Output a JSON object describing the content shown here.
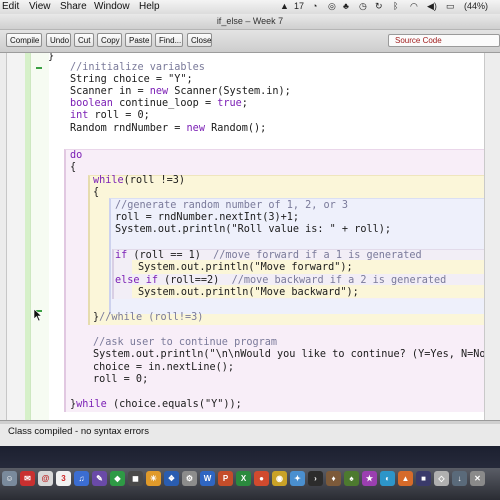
{
  "menubar": {
    "items": [
      "Edit",
      "View",
      "Share",
      "Window",
      "Help"
    ],
    "battery": "(44%)",
    "tray_count": "17"
  },
  "window": {
    "title": "if_else – Week 7"
  },
  "toolbar": {
    "compile": "Compile",
    "undo": "Undo",
    "cut": "Cut",
    "copy": "Copy",
    "paste": "Paste",
    "find": "Find...",
    "close": "Close",
    "view_select": "Source Code"
  },
  "code": {
    "l0": "}",
    "comment_init": "//initialize variables",
    "l_choice": "String choice = \"Y\";",
    "l_scanner_a": "Scanner in = ",
    "l_scanner_kw": "new",
    "l_scanner_b": " Scanner(System.in);",
    "l_bool_kw": "boolean",
    "l_bool_b": " continue_loop = ",
    "l_bool_kw2": "true",
    "l_bool_c": ";",
    "l_int_kw": "int",
    "l_int_b": " roll = 0;",
    "l_random_a": "Random rndNumber = ",
    "l_random_kw": "new",
    "l_random_b": " Random();",
    "do_kw": "do",
    "brace_open": "{",
    "while_kw": "while",
    "while_cond": "(roll !=3)",
    "brace_open2": "{",
    "comment_gen": "//generate random number of 1, 2, or 3",
    "l_roll": "roll = rndNumber.nextInt(3)+1;",
    "l_print_roll": "System.out.println(\"Roll value is: \" + roll);",
    "if_kw": "if",
    "if_cond": " (roll == 1)  ",
    "if_comment": "//move forward if a 1 is generated",
    "l_print_fwd": "System.out.println(\"Move forward\");",
    "else_kw": "else",
    "elseif_kw": "if",
    "elseif_cond": " (roll==2)  ",
    "elseif_comment": "//move backward if a 2 is generated",
    "l_print_back": "System.out.println(\"Move backward\");",
    "close_while": "}",
    "close_while_comment": "//while (roll!=3)",
    "comment_ask": "//ask user to continue program",
    "l_print_ask": "System.out.println(\"\\n\\nWould you like to continue? (Y=Yes, N=No)\");",
    "l_choice_in": "choice = in.nextLine();",
    "l_roll_reset": "roll = 0;",
    "l_dowhile_a": "}",
    "l_dowhile_kw": "while",
    "l_dowhile_b": " (choice.equals(\"Y\"));"
  },
  "status": {
    "message": "Class compiled - no syntax errors"
  },
  "dock": {
    "calendar_day": "3"
  },
  "colors": {
    "keyword": "#7b1fb5",
    "keyword_orange": "#cc6b00",
    "comment": "#7a7a9a",
    "do_block_bg": "#f8eef8",
    "while_block_bg": "#fbf6d9",
    "inner_block_bg": "#eef0fb",
    "if_block_bg": "#f2eef6"
  }
}
